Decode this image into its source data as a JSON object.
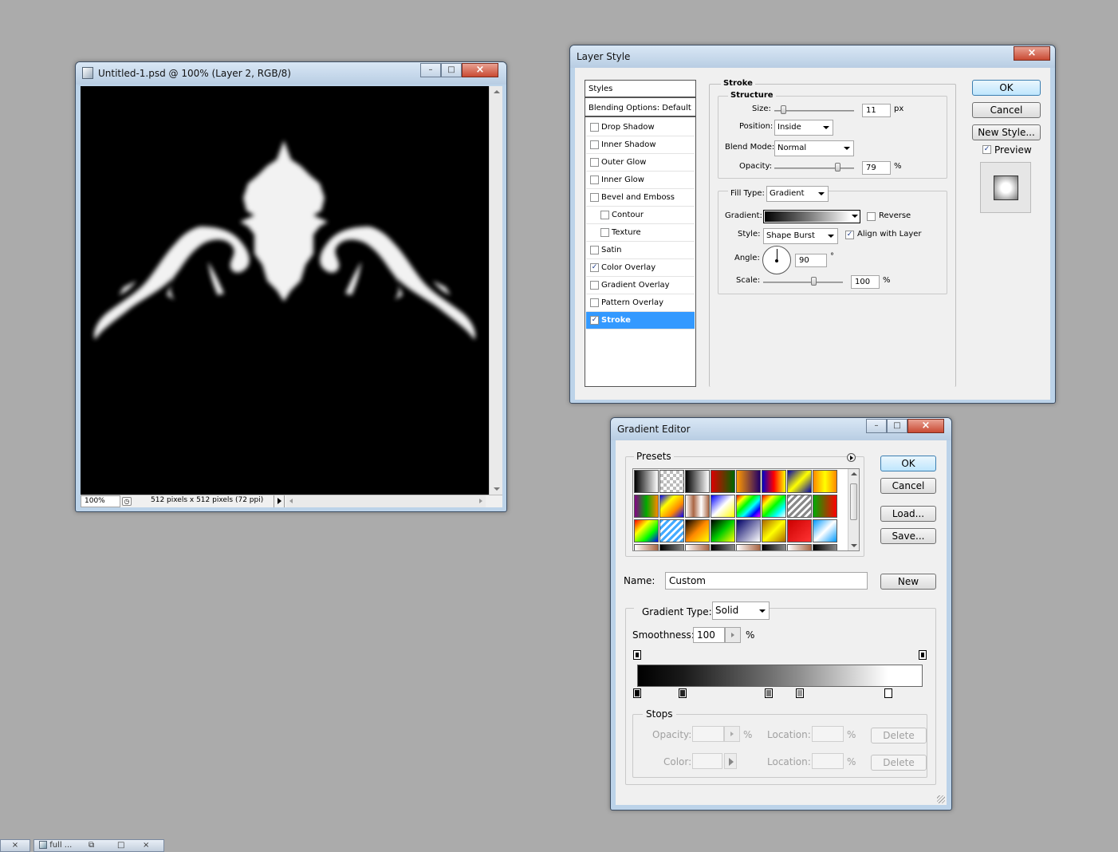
{
  "doc_window": {
    "title": "Untitled-1.psd @ 100% (Layer 2, RGB/8)",
    "zoom": "100%",
    "status_info": "512 pixels x 512 pixels (72 ppi)"
  },
  "layer_style": {
    "title": "Layer Style",
    "styles_header": "Styles",
    "blending_options": "Blending Options: Default",
    "styles": [
      {
        "label": "Drop Shadow",
        "checked": false
      },
      {
        "label": "Inner Shadow",
        "checked": false
      },
      {
        "label": "Outer Glow",
        "checked": false
      },
      {
        "label": "Inner Glow",
        "checked": false
      },
      {
        "label": "Bevel and Emboss",
        "checked": false
      },
      {
        "label": "Contour",
        "checked": false
      },
      {
        "label": "Texture",
        "checked": false
      },
      {
        "label": "Satin",
        "checked": false
      },
      {
        "label": "Color Overlay",
        "checked": true
      },
      {
        "label": "Gradient Overlay",
        "checked": false
      },
      {
        "label": "Pattern Overlay",
        "checked": false
      },
      {
        "label": "Stroke",
        "checked": true
      }
    ],
    "stroke_heading": "Stroke",
    "structure_heading": "Structure",
    "size_label": "Size:",
    "size_value": "11",
    "size_unit": "px",
    "position_label": "Position:",
    "position_value": "Inside",
    "blend_mode_label": "Blend Mode:",
    "blend_mode_value": "Normal",
    "opacity_label": "Opacity:",
    "opacity_value": "79",
    "opacity_unit": "%",
    "fill_type_label": "Fill Type:",
    "fill_type_value": "Gradient",
    "gradient_label": "Gradient:",
    "reverse_label": "Reverse",
    "reverse_checked": false,
    "style_label": "Style:",
    "style_value": "Shape Burst",
    "align_label": "Align with Layer",
    "align_checked": true,
    "angle_label": "Angle:",
    "angle_value": "90",
    "angle_unit": "°",
    "scale_label": "Scale:",
    "scale_value": "100",
    "scale_unit": "%",
    "ok_label": "OK",
    "cancel_label": "Cancel",
    "new_style_label": "New Style...",
    "preview_label": "Preview",
    "preview_checked": true
  },
  "gradient_editor": {
    "title": "Gradient Editor",
    "presets_label": "Presets",
    "ok_label": "OK",
    "cancel_label": "Cancel",
    "load_label": "Load...",
    "save_label": "Save...",
    "name_label": "Name:",
    "name_value": "Custom",
    "new_label": "New",
    "gradient_type_label": "Gradient Type:",
    "gradient_type_value": "Solid",
    "smoothness_label": "Smoothness:",
    "smoothness_value": "100",
    "smoothness_unit": "%",
    "stops_label": "Stops",
    "stop_opacity_label": "Opacity:",
    "stop_color_label": "Color:",
    "location_label": "Location:",
    "percent": "%",
    "delete_label": "Delete",
    "color_stops": [
      {
        "location": 0,
        "color": "#000000"
      },
      {
        "location": 0.16,
        "color": "#222222"
      },
      {
        "location": 0.46,
        "color": "#777777"
      },
      {
        "location": 0.57,
        "color": "#999999"
      },
      {
        "location": 0.88,
        "color": "#ffffff"
      }
    ],
    "opacity_stops": [
      0,
      1
    ]
  },
  "taskbar": {
    "item_label": "full ..."
  }
}
